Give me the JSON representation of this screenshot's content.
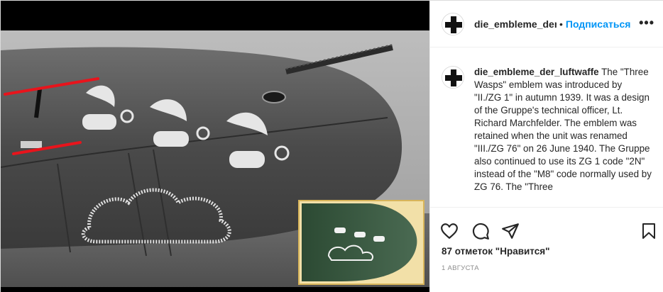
{
  "post": {
    "username": "die_embleme_der_l",
    "separator": "•",
    "follow_label": "Подписаться",
    "more_icon": "more-options-icon"
  },
  "caption": {
    "username": "die_embleme_der_luftwaffe",
    "text": "The \"Three Wasps\" emblem was introduced by \"II./ZG 1\" in autumn 1939. It was a design of the Gruppe's technical officer, Lt. Richard Marchfelder. The emblem was retained when the unit was renamed \"III./ZG 76\" on 26 June 1940. The Gruppe also continued to use its ZG 1 code \"2N\" instead of the \"M8\" code normally used by ZG 76. The \"Three"
  },
  "actions": {
    "like_icon": "heart-icon",
    "comment_icon": "comment-icon",
    "share_icon": "share-icon",
    "save_icon": "bookmark-icon"
  },
  "likes_text": "87 отметок \"Нравится\"",
  "date_text": "1 АВГУСТА",
  "colors": {
    "accent": "#0095f6",
    "text": "#262626",
    "muted": "#8e8e8e",
    "annotation": "#e8141c"
  }
}
